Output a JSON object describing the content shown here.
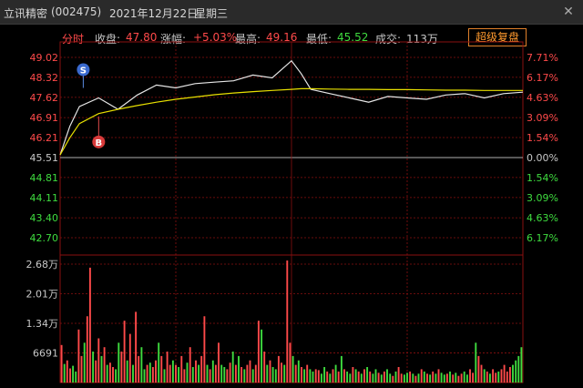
{
  "window": {
    "stock_name": "立讯精密",
    "stock_code": "(002475)",
    "date": "2021年12月22日",
    "weekday": "星期三",
    "close_icon": "close-icon"
  },
  "info_bar": {
    "mode_label": "分时",
    "close_label": "收盘:",
    "close_value": "47.80",
    "change_label": "涨幅:",
    "change_value": "+5.03%",
    "high_label": "最高:",
    "high_value": "49.16",
    "low_label": "最低:",
    "low_value": "45.52",
    "volume_label": "成交:",
    "volume_value": "113万",
    "super_button": "超级复盘"
  },
  "colors": {
    "up": "#ff4a4a",
    "down": "#3fdc3f",
    "neutral": "#c8c8c8",
    "price_line": "#e6e6e6",
    "avg_line": "#e8e000",
    "grid": "#8a1010",
    "accent": "#ff9a2e"
  },
  "chart_data": [
    {
      "type": "line",
      "title": "",
      "y_left_ticks": [
        "49.02",
        "48.32",
        "47.62",
        "46.91",
        "46.21",
        "45.51",
        "44.81",
        "44.11",
        "43.40",
        "42.70"
      ],
      "y_right_ticks": [
        "7.71%",
        "6.17%",
        "4.63%",
        "3.09%",
        "1.54%",
        "0.00%",
        "1.54%",
        "3.09%",
        "4.63%",
        "6.17%"
      ],
      "ylim": [
        42.35,
        49.37
      ],
      "prev_close": 45.51,
      "x_minutes": [
        0,
        5,
        10,
        20,
        30,
        40,
        50,
        60,
        70,
        80,
        90,
        100,
        110,
        120,
        125,
        130,
        140,
        150,
        160,
        170,
        180,
        190,
        200,
        210,
        220,
        230,
        240
      ],
      "series": [
        {
          "values": [
            45.6,
            46.6,
            47.3,
            47.6,
            47.2,
            47.7,
            48.05,
            47.95,
            48.1,
            48.15,
            48.2,
            48.4,
            48.3,
            48.9,
            48.45,
            47.9,
            47.75,
            47.6,
            47.45,
            47.65,
            47.6,
            47.55,
            47.7,
            47.75,
            47.6,
            47.75,
            47.8
          ]
        },
        {
          "values": [
            45.6,
            46.2,
            46.7,
            47.05,
            47.2,
            47.33,
            47.45,
            47.55,
            47.63,
            47.71,
            47.77,
            47.82,
            47.86,
            47.9,
            47.92,
            47.92,
            47.91,
            47.9,
            47.9,
            47.89,
            47.89,
            47.88,
            47.87,
            47.87,
            47.86,
            47.86,
            47.86
          ]
        }
      ],
      "markers": [
        {
          "label": "S",
          "x": 12,
          "y": 47.95
        },
        {
          "label": "B",
          "x": 20,
          "y": 46.95
        }
      ]
    },
    {
      "type": "bar",
      "title": "",
      "y_ticks": [
        "2.68万",
        "2.01万",
        "1.34万",
        "6691"
      ],
      "ylim": [
        0,
        26800
      ],
      "values": [
        8500,
        4200,
        5000,
        3200,
        3800,
        2500,
        12000,
        6000,
        9000,
        15000,
        26000,
        7000,
        5000,
        10000,
        6000,
        8000,
        4000,
        4500,
        3500,
        3000,
        9000,
        7000,
        14000,
        5000,
        11000,
        4000,
        16000,
        6000,
        8000,
        3000,
        4000,
        4500,
        3500,
        5000,
        9000,
        6000,
        3000,
        7000,
        4000,
        5000,
        4000,
        3500,
        6000,
        3000,
        4500,
        8000,
        3500,
        5000,
        4000,
        6000,
        15000,
        4000,
        3000,
        5000,
        4000,
        9000,
        4000,
        3500,
        3000,
        4500,
        7000,
        4000,
        6000,
        3500,
        3000,
        4000,
        5000,
        3000,
        4000,
        14000,
        12000,
        7000,
        4000,
        5000,
        3500,
        3000,
        6000,
        4500,
        4000,
        28000,
        9000,
        6000,
        4000,
        5000,
        3500,
        3000,
        4000,
        3000,
        2500,
        3000,
        2800,
        2000,
        3500,
        2500,
        2000,
        3000,
        4000,
        2500,
        6000,
        3000,
        2500,
        2000,
        3500,
        3000,
        2500,
        2000,
        3000,
        3500,
        2500,
        2000,
        3000,
        2200,
        1800,
        2500,
        3000,
        2000,
        1500,
        2500,
        3500,
        2000,
        1800,
        2200,
        2500,
        2000,
        1500,
        2000,
        3000,
        2500,
        2000,
        1800,
        2500,
        2000,
        3000,
        2200,
        1800,
        2000,
        2500,
        1800,
        2200,
        1500,
        2000,
        2500,
        1800,
        3000,
        2200,
        9000,
        6000,
        4000,
        3000,
        2500,
        2000,
        3000,
        2200,
        2500,
        3000,
        4000,
        2500,
        3500,
        4000,
        5000,
        6000,
        8000
      ],
      "directions": [
        "u",
        "d",
        "u",
        "u",
        "d",
        "d",
        "u",
        "u",
        "d",
        "u",
        "u",
        "d",
        "u",
        "u",
        "d",
        "u",
        "d",
        "u",
        "u",
        "d",
        "d",
        "u",
        "u",
        "d",
        "u",
        "d",
        "u",
        "u",
        "d",
        "d",
        "u",
        "d",
        "u",
        "u",
        "d",
        "u",
        "d",
        "u",
        "u",
        "d",
        "u",
        "d",
        "u",
        "u",
        "d",
        "u",
        "d",
        "u",
        "d",
        "u",
        "u",
        "d",
        "u",
        "d",
        "u",
        "u",
        "d",
        "d",
        "u",
        "u",
        "d",
        "u",
        "d",
        "u",
        "d",
        "u",
        "u",
        "d",
        "u",
        "u",
        "d",
        "u",
        "d",
        "u",
        "d",
        "d",
        "u",
        "u",
        "d",
        "u",
        "u",
        "d",
        "u",
        "d",
        "u",
        "d",
        "u",
        "d",
        "d",
        "u",
        "u",
        "d",
        "d",
        "u",
        "d",
        "u",
        "d",
        "u",
        "d",
        "u",
        "d",
        "d",
        "u",
        "d",
        "u",
        "d",
        "u",
        "d",
        "u",
        "d",
        "d",
        "u",
        "d",
        "u",
        "d",
        "d",
        "u",
        "d",
        "u",
        "u",
        "d",
        "d",
        "u",
        "d",
        "u",
        "d",
        "u",
        "d",
        "u",
        "d",
        "u",
        "d",
        "u",
        "d",
        "d",
        "u",
        "d",
        "u",
        "d",
        "u",
        "u",
        "d",
        "d",
        "u",
        "u",
        "d",
        "u",
        "u",
        "d",
        "u",
        "d",
        "u",
        "u",
        "d",
        "u",
        "u",
        "u",
        "u"
      ]
    }
  ]
}
